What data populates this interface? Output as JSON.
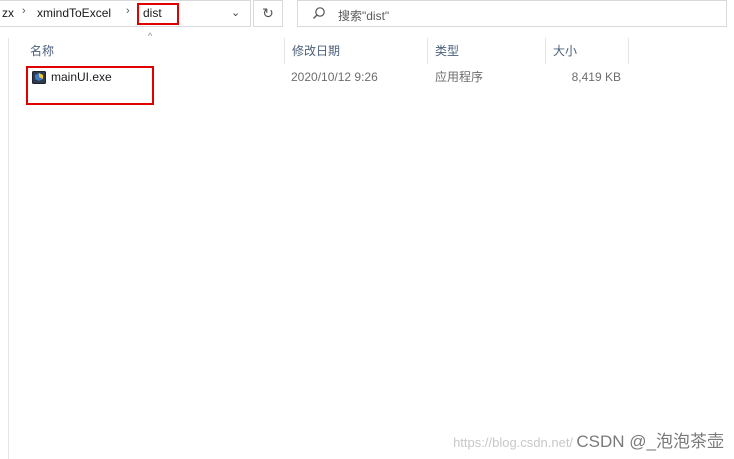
{
  "address_bar": {
    "crumbs": [
      "zx",
      "xmindToExcel",
      "dist"
    ],
    "separator": "›",
    "dropdown": "⌄",
    "refresh": "↻"
  },
  "search": {
    "placeholder": "搜索\"dist\""
  },
  "columns": {
    "name": "名称",
    "date": "修改日期",
    "type": "类型",
    "size": "大小",
    "sort_indicator": "^"
  },
  "files": [
    {
      "name": "mainUI.exe",
      "date": "2020/10/12 9:26",
      "type": "应用程序",
      "size": "8,419 KB",
      "icon": "exe-app-icon"
    }
  ],
  "watermark": {
    "faint": "https://blog.csdn.net/",
    "strong": "CSDN @_泡泡茶壶"
  },
  "colors": {
    "highlight_box": "#e00000",
    "header_text": "#4c607a"
  }
}
